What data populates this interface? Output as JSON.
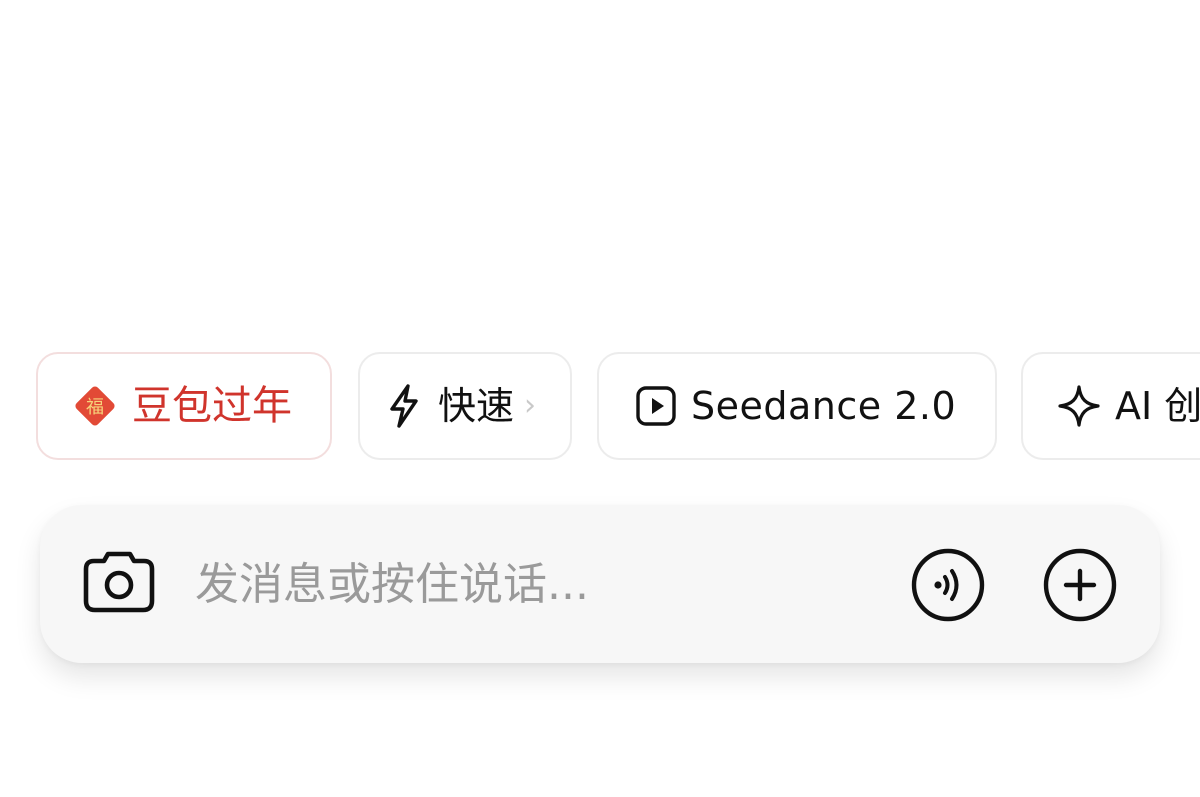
{
  "chips": {
    "festival": {
      "label": "豆包过年",
      "icon": "fu-diamond-icon",
      "icon_char": "福",
      "color": "#d0342c"
    },
    "fast": {
      "label": "快速",
      "icon": "lightning-icon",
      "more": "›"
    },
    "seedance": {
      "label": "Seedance 2.0",
      "icon": "play-square-icon"
    },
    "ai": {
      "label": "AI 创",
      "icon": "sparkle-icon"
    }
  },
  "composer": {
    "placeholder": "发消息或按住说话...",
    "value": "",
    "camera_icon": "camera-icon",
    "voice_icon": "voice-wave-icon",
    "plus_icon": "plus-circle-icon"
  }
}
